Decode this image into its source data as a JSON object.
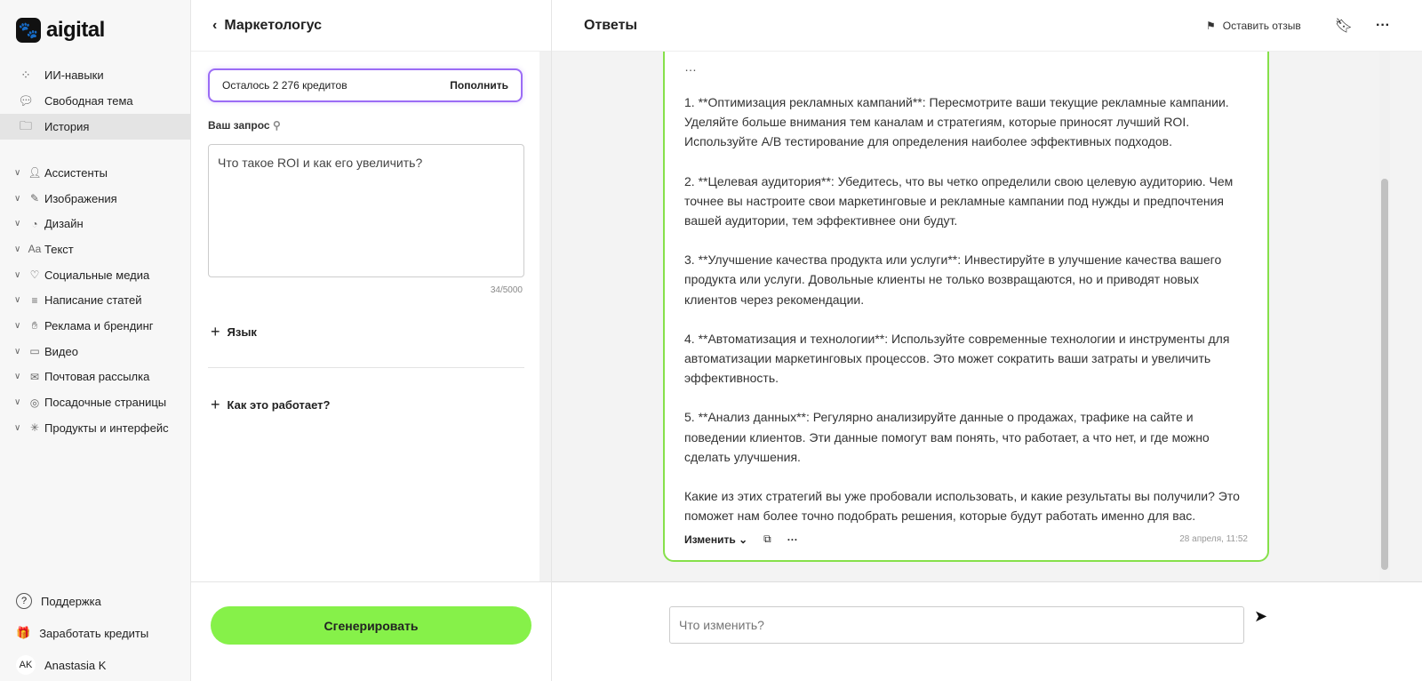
{
  "brand": {
    "name": "aigital",
    "accent": "#86f149"
  },
  "sidebar": {
    "nav": [
      {
        "label": "ИИ-навыки",
        "icon": "grid-icon"
      },
      {
        "label": "Свободная тема",
        "icon": "chat-icon"
      },
      {
        "label": "История",
        "icon": "folder-icon",
        "active": true
      }
    ],
    "categories": [
      {
        "label": "Ассистенты",
        "icon": "assistant-icon"
      },
      {
        "label": "Изображения",
        "icon": "brush-icon"
      },
      {
        "label": "Дизайн",
        "icon": "palette-icon"
      },
      {
        "label": "Текст",
        "icon": "text-icon"
      },
      {
        "label": "Социальные медиа",
        "icon": "heart-icon"
      },
      {
        "label": "Написание статей",
        "icon": "lines-icon"
      },
      {
        "label": "Реклама и брендинг",
        "icon": "clap-icon"
      },
      {
        "label": "Видео",
        "icon": "video-icon"
      },
      {
        "label": "Почтовая рассылка",
        "icon": "mail-icon"
      },
      {
        "label": "Посадочные страницы",
        "icon": "cursor-icon"
      },
      {
        "label": "Продукты и интерфейс",
        "icon": "sparkle-icon"
      }
    ],
    "support": "Поддержка",
    "earn": "Заработать кредиты",
    "user": {
      "initials": "AK",
      "name": "Anastasia K"
    }
  },
  "form": {
    "back_title": "Маркетологус",
    "credits": "Осталось 2 276 кредитов",
    "topup": "Пополнить",
    "query_label": "Ваш запрос",
    "query_value": "Что такое ROI и как его увеличить?",
    "counter": "34/5000",
    "language": "Язык",
    "how": "Как это работает?",
    "generate": "Сгенерировать"
  },
  "answers": {
    "title": "Ответы",
    "feedback": "Оставить отзыв",
    "paragraphs": [
      "…",
      "1. **Оптимизация рекламных кампаний**: Пересмотрите ваши текущие рекламные кампании. Уделяйте больше внимания тем каналам и стратегиям, которые приносят лучший ROI. Используйте A/B тестирование для определения наиболее эффективных подходов.",
      "2. **Целевая аудитория**: Убедитесь, что вы четко определили свою целевую аудиторию. Чем точнее вы настроите свои маркетинговые и рекламные кампании под нужды и предпочтения вашей аудитории, тем эффективнее они будут.",
      "3. **Улучшение качества продукта или услуги**: Инвестируйте в улучшение качества вашего продукта или услуги. Довольные клиенты не только возвращаются, но и приводят новых клиентов через рекомендации.",
      "4. **Автоматизация и технологии**: Используйте современные технологии и инструменты для автоматизации маркетинговых процессов. Это может сократить ваши затраты и увеличить эффективность.",
      "5. **Анализ данных**: Регулярно анализируйте данные о продажах, трафике на сайте и поведении клиентов. Эти данные помогут вам понять, что работает, а что нет, и где можно сделать улучшения.",
      "Какие из этих стратегий вы уже пробовали использовать, и какие результаты вы получили? Это поможет нам более точно подобрать решения, которые будут работать именно для вас."
    ],
    "edit": "Изменить",
    "timestamp": "28 апреля, 11:52",
    "input_placeholder": "Что изменить?"
  }
}
